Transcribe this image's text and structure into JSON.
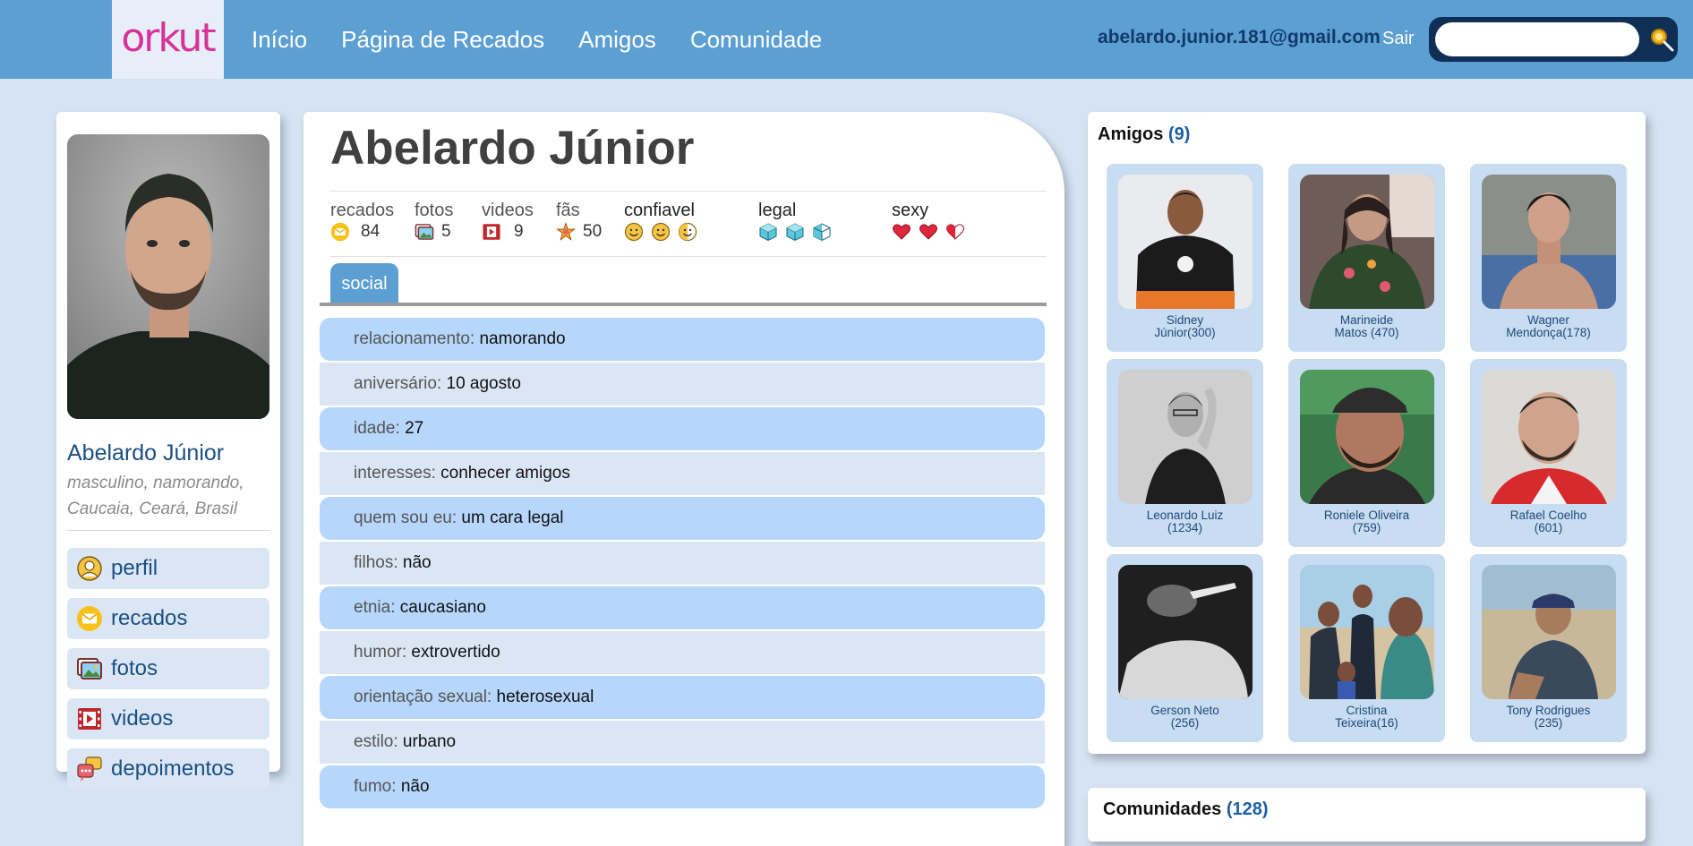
{
  "header": {
    "logo": "orkut",
    "nav": [
      "Início",
      "Página de Recados",
      "Amigos",
      "Comunidade"
    ],
    "user_email": "abelardo.junior.181@gmail.com",
    "logout": "Sair",
    "search_placeholder": ""
  },
  "sidebar": {
    "name": "Abelardo Júnior",
    "info": "masculino, namorando, Caucaia, Ceará, Brasil",
    "menu": [
      {
        "label": "perfil",
        "icon": "user-circle-icon"
      },
      {
        "label": "recados",
        "icon": "envelope-icon"
      },
      {
        "label": "fotos",
        "icon": "photos-icon"
      },
      {
        "label": "videos",
        "icon": "film-icon"
      },
      {
        "label": "depoimentos",
        "icon": "speech-bubbles-icon"
      }
    ]
  },
  "profile": {
    "title": "Abelardo Júnior",
    "stats": {
      "recados": {
        "label": "recados",
        "value": "84"
      },
      "fotos": {
        "label": "fotos",
        "value": "5"
      },
      "videos": {
        "label": "videos",
        "value": "9"
      },
      "fas": {
        "label": "fãs",
        "value": "50"
      }
    },
    "ratings": {
      "confiavel": {
        "label": "confiavel",
        "level": 2.5,
        "max": 3
      },
      "legal": {
        "label": "legal",
        "level": 2.5,
        "max": 3
      },
      "sexy": {
        "label": "sexy",
        "level": 2.5,
        "max": 3
      }
    },
    "tab": "social",
    "rows": [
      {
        "k": "relacionamento:",
        "v": "namorando"
      },
      {
        "k": "aniversário:",
        "v": "10 agosto"
      },
      {
        "k": "idade:",
        "v": "27"
      },
      {
        "k": "interesses:",
        "v": "conhecer amigos"
      },
      {
        "k": "quem sou eu:",
        "v": "um cara legal"
      },
      {
        "k": "filhos:",
        "v": "não"
      },
      {
        "k": "etnia:",
        "v": "caucasiano"
      },
      {
        "k": "humor:",
        "v": "extrovertido"
      },
      {
        "k": "orientação sexual:",
        "v": "heterosexual"
      },
      {
        "k": "estilo:",
        "v": "urbano"
      },
      {
        "k": "fumo:",
        "v": "não"
      }
    ]
  },
  "friends": {
    "title": "Amigos",
    "count": "(9)",
    "items": [
      {
        "line1": "Sidney",
        "line2": "Júnior(300)"
      },
      {
        "line1": "Marineide",
        "line2": "Matos (470)"
      },
      {
        "line1": "Wagner",
        "line2": "Mendonça(178)"
      },
      {
        "line1": "Leonardo Luiz",
        "line2": "(1234)"
      },
      {
        "line1": "Roniele Oliveira",
        "line2": "(759)"
      },
      {
        "line1": "Rafael Coelho",
        "line2": "(601)"
      },
      {
        "line1": "Gerson Neto",
        "line2": "(256)"
      },
      {
        "line1": "Cristina",
        "line2": "Teixeira(16)"
      },
      {
        "line1": "Tony Rodrigues",
        "line2": "(235)"
      }
    ]
  },
  "communities": {
    "title": "Comunidades",
    "count": "(128)"
  },
  "colors": {
    "topbar": "#5c9fd3",
    "page_bg": "#d5e3f4",
    "row_dark": "#b6d6fb",
    "row_light": "#dbe6f5",
    "link": "#1a4f82",
    "logo": "#d6329a"
  }
}
